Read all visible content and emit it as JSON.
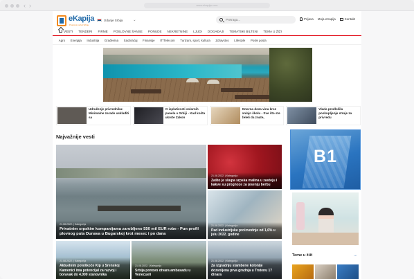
{
  "browser": {
    "url": "www.ekapija.com"
  },
  "header": {
    "logo_text": "eKapija",
    "logo_subtitle": "Poslovni portal Srbije",
    "edition": "Izdanje Srbija",
    "search_placeholder": "Pretraga...",
    "links": {
      "login": "Prijava",
      "my": "Moja eKapija",
      "contact": "Kontakt"
    }
  },
  "main_nav": [
    "VESTI",
    "TENDERI",
    "FIRME",
    "POSLOVNE ŠANSE",
    "PONUDE",
    "NEKRETNINE",
    "LJUDI",
    "DOGAĐAJI",
    "TEMATSKI BILTENI",
    "TEMA U ŽIŽI"
  ],
  "sub_nav": [
    "Agro",
    "Energija",
    "Industrija",
    "Građevina",
    "Saobraćaj",
    "Finansije",
    "IT/Telecom",
    "Turizam, sport, kultura",
    "Zdravstvo",
    "Lifestyle",
    "Posle posla"
  ],
  "news_row": [
    {
      "title": "Udruženje privrednika: Minimalne zarade usklađiti sa",
      "thumb": "#5f5a55"
    },
    {
      "title": "O isplativosti solarnih panela u Srbiji - Kad košta ukrste Zakon",
      "thumb": "#2f2f33"
    },
    {
      "title": "Dnevna doza vina kroz onlajn školu - Sve što ste želeli da znate,",
      "thumb": "#c9b79d"
    },
    {
      "title": "Vlada predložila poskupljenje struje za privredu",
      "thumb": "#5b6a7d"
    }
  ],
  "section_title": "Najvažnije vesti",
  "featured": [
    {
      "meta": "21.08.2022. | Kategorija",
      "title": "Privatnim srpskim kompanijama zarobljeno 550 mil EUR robe - Pun profil plovnog puta Dunava u Bugarskoj krot mesec i po dana"
    },
    {
      "meta": "21.08.2022. | Kategorija",
      "title": "Zašto je skupa srpska malina u zastoju i kakve su prognoze za jesenju berbu"
    },
    {
      "meta": "21.08.2022. | Kategorija",
      "title": "Pad industrijske proizvodnje od 1,6% u julu 2022. godine"
    },
    {
      "meta": "21.08.2022. | Kategorija",
      "title": "Aktuelnim poteškoće Kip u Srenskoj Kamenici ima potencijal za razvoj i boravak do 4.000 stanovnika"
    },
    {
      "meta": "21.08.2022. | Kategorija",
      "title": "Srbija ponovo otvara ambasadu u Venecueli"
    },
    {
      "meta": "21.08.2022. | Kategorija",
      "title": "Za izgradnju stambene kolonije dozvoljena prva gradnja u Trstenu 17 dinara"
    }
  ],
  "ad": {
    "label": "B1"
  },
  "themes": {
    "title": "Teme u žiži",
    "arrow": "→"
  },
  "colors": {
    "brand_blue": "#1f69a8",
    "brand_orange": "#f28a1f",
    "nav_red": "#e10613",
    "ad_blue": "#2a74c0"
  }
}
